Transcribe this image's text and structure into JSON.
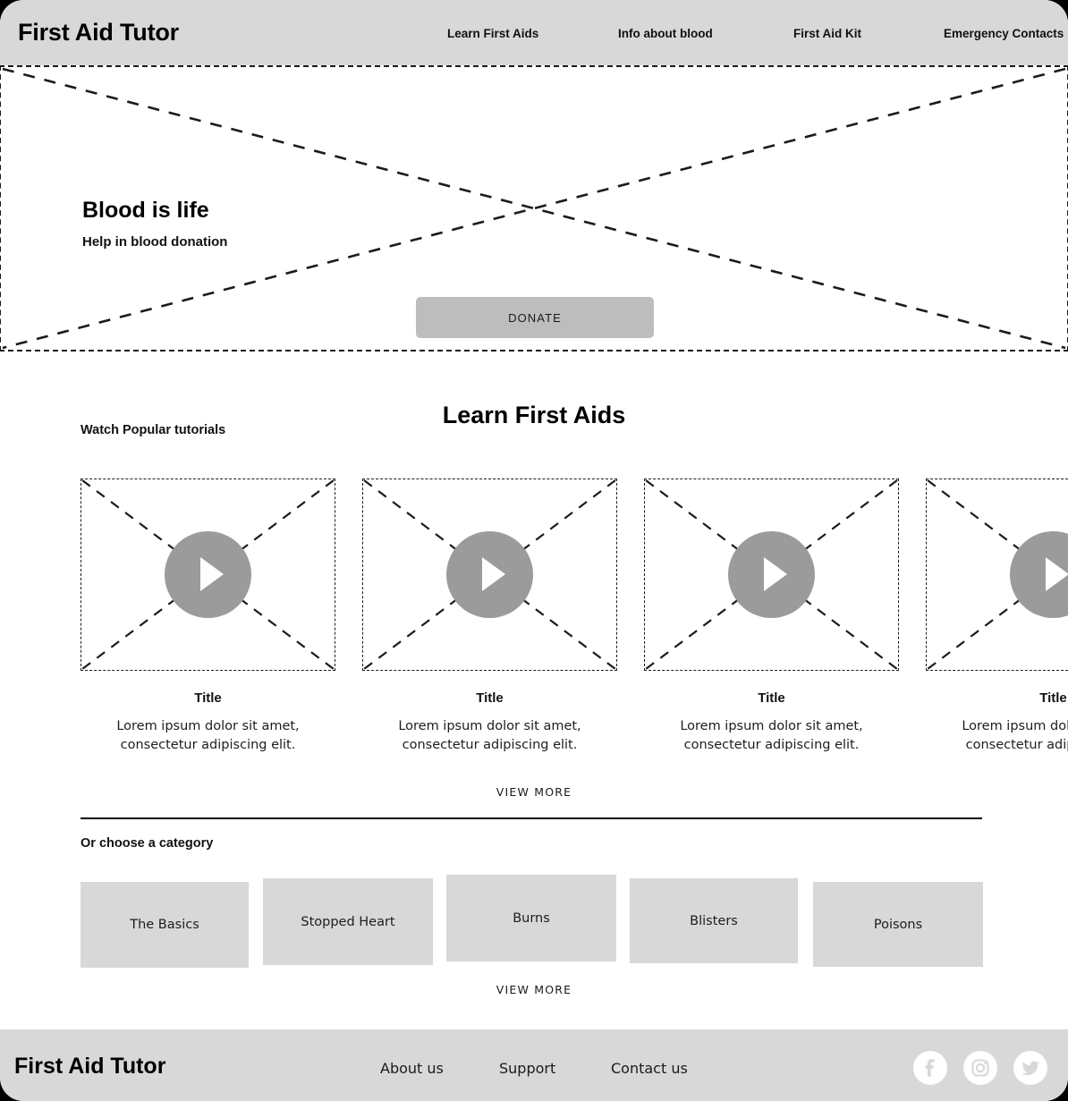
{
  "header": {
    "brand": "First Aid Tutor",
    "nav": [
      {
        "label": "Learn First Aids"
      },
      {
        "label": "Info about blood"
      },
      {
        "label": "First Aid Kit"
      },
      {
        "label": "Emergency Contacts"
      }
    ]
  },
  "hero": {
    "title": "Blood is life",
    "subtitle": "Help in blood donation",
    "donate_label": "DONATE",
    "placeholder_icon": "image-placeholder-cross"
  },
  "learn": {
    "section_title": "Learn First Aids",
    "watch_label": "Watch Popular tutorials",
    "cards": [
      {
        "title": "Title",
        "desc": "Lorem ipsum dolor sit amet, consectetur adipiscing elit.",
        "play_icon": "play-icon"
      },
      {
        "title": "Title",
        "desc": "Lorem ipsum dolor sit amet, consectetur adipiscing elit.",
        "play_icon": "play-icon"
      },
      {
        "title": "Title",
        "desc": "Lorem ipsum dolor sit amet, consectetur adipiscing elit.",
        "play_icon": "play-icon"
      },
      {
        "title": "Title",
        "desc": "Lorem ipsum dolor sit amet, consectetur adipiscing elit.",
        "play_icon": "play-icon"
      }
    ],
    "view_more_label": "VIEW MORE"
  },
  "categories": {
    "label": "Or choose a category",
    "items": [
      {
        "label": "The Basics"
      },
      {
        "label": "Stopped Heart"
      },
      {
        "label": "Burns"
      },
      {
        "label": "Blisters"
      },
      {
        "label": "Poisons"
      }
    ],
    "view_more_label": "VIEW MORE"
  },
  "footer": {
    "brand": "First Aid Tutor",
    "links": [
      {
        "label": "About us"
      },
      {
        "label": "Support"
      },
      {
        "label": "Contact us"
      }
    ],
    "socials": [
      {
        "name": "facebook-icon"
      },
      {
        "name": "instagram-icon"
      },
      {
        "name": "twitter-icon"
      }
    ]
  },
  "colors": {
    "bar_gray": "#d8d8d8",
    "button_gray": "#bdbdbd",
    "play_gray": "#9b9b9b",
    "page_bg": "#ffffff",
    "outline": "#1b1b1b"
  }
}
